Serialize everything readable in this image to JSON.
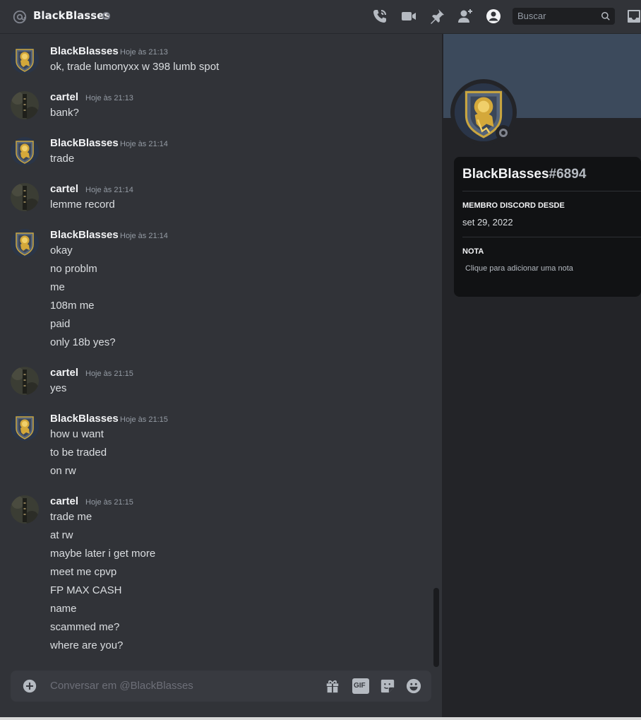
{
  "header": {
    "title": "BlackBlasses",
    "search_placeholder": "Buscar",
    "icons": [
      "at-icon",
      "phone-call-icon",
      "video-call-icon",
      "pin-icon",
      "add-friend-icon",
      "profile-toggle-icon",
      "search-icon",
      "inbox-icon"
    ]
  },
  "messages": [
    {
      "author": "BlackBlasses",
      "time": "Hoje às 21:13",
      "lines": [
        "ok, trade lumonyxx w 398 lumb spot"
      ]
    },
    {
      "author": "cartel",
      "time": "Hoje às 21:13",
      "lines": [
        "bank?"
      ]
    },
    {
      "author": "BlackBlasses",
      "time": "Hoje às 21:14",
      "lines": [
        "trade"
      ]
    },
    {
      "author": "cartel",
      "time": "Hoje às 21:14",
      "lines": [
        "lemme record"
      ]
    },
    {
      "author": "BlackBlasses",
      "time": "Hoje às 21:14",
      "lines": [
        "okay",
        "no problm",
        "me",
        "108m me",
        "paid",
        "only 18b yes?"
      ]
    },
    {
      "author": "cartel",
      "time": "Hoje às 21:15",
      "lines": [
        "yes"
      ]
    },
    {
      "author": "BlackBlasses",
      "time": "Hoje às 21:15",
      "lines": [
        "how u want",
        "to be traded",
        "on rw"
      ]
    },
    {
      "author": "cartel",
      "time": "Hoje às 21:15",
      "lines": [
        "trade me",
        "at rw",
        "maybe later i get more",
        "meet me cpvp",
        "FP MAX CASH",
        "name",
        "scammed me?",
        "where are you?"
      ]
    }
  ],
  "composer": {
    "placeholder": "Conversar em @BlackBlasses",
    "icons": [
      "add-attachment-icon",
      "gift-icon",
      "gif-icon",
      "sticker-icon",
      "emoji-icon"
    ],
    "gif_label": "GIF"
  },
  "profile": {
    "username": "BlackBlasses",
    "discriminator": "#6894",
    "member_since_label": "MEMBRO DISCORD DESDE",
    "member_since_value": "set 29, 2022",
    "note_label": "NOTA",
    "note_placeholder": "Clique para adicionar uma nota"
  },
  "colors": {
    "background": "#313338",
    "panel": "#232428",
    "card": "#111214",
    "banner": "#3c4a5c",
    "offline_status": "#80848e"
  }
}
